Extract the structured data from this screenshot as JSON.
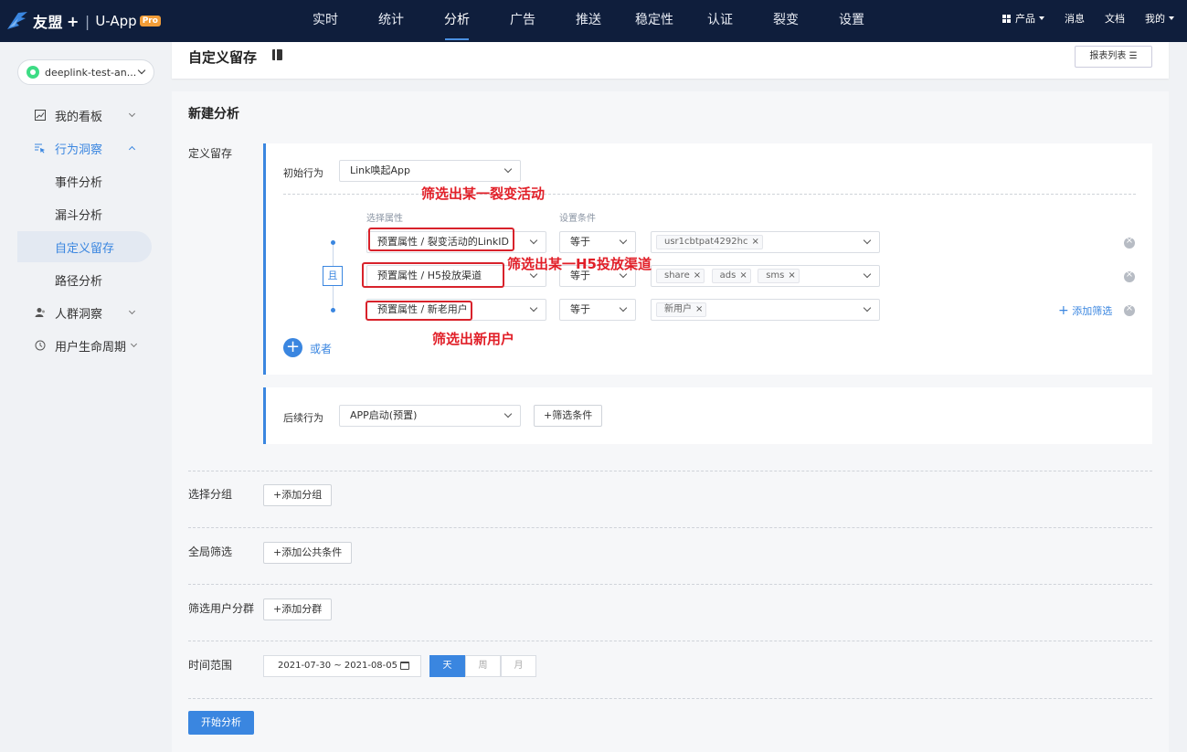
{
  "topbar": {
    "brand": "友盟",
    "brand_plus": "+",
    "separator": "|",
    "product": "U-App",
    "badge": "Pro",
    "tabs": [
      "实时",
      "统计",
      "分析",
      "广告",
      "推送",
      "稳定性",
      "认证",
      "裂变",
      "设置"
    ],
    "active_tab": "分析",
    "right": {
      "products": "产品",
      "messages": "消息",
      "docs": "文档",
      "mine": "我的"
    }
  },
  "sidebar": {
    "app_name": "deeplink-test-an...",
    "items": [
      {
        "label": "我的看板",
        "icon": "chart-icon",
        "expanded": false
      },
      {
        "label": "行为洞察",
        "icon": "cursor-list-icon",
        "expanded": true
      },
      {
        "label": "事件分析"
      },
      {
        "label": "漏斗分析"
      },
      {
        "label": "自定义留存",
        "active": true
      },
      {
        "label": "路径分析"
      },
      {
        "label": "人群洞察",
        "icon": "user-group-icon",
        "expanded": false
      },
      {
        "label": "用户生命周期",
        "icon": "cycle-icon",
        "expanded": false
      }
    ]
  },
  "header": {
    "title": "自定义留存",
    "report_list": "报表列表"
  },
  "main": {
    "section_title": "新建分析",
    "define_label": "定义留存",
    "initial": {
      "label": "初始行为",
      "value": "Link唤起App",
      "attr_hint": "选择属性",
      "cond_hint": "设置条件",
      "and_label": "且",
      "filters": [
        {
          "attr": "预置属性 / 裂变活动的LinkID",
          "op": "等于",
          "tags": [
            "usr1cbtpat4292hc"
          ]
        },
        {
          "attr": "预置属性 / H5投放渠道",
          "op": "等于",
          "tags": [
            "share",
            "ads",
            "sms"
          ]
        },
        {
          "attr": "预置属性 / 新老用户",
          "op": "等于",
          "tags": [
            "新用户"
          ]
        }
      ],
      "add_filter": "添加筛选",
      "or_label": "或者"
    },
    "annotations": [
      "筛选出某一裂变活动",
      "筛选出某一H5投放渠道",
      "筛选出新用户"
    ],
    "followup": {
      "label": "后续行为",
      "value": "APP启动(预置)",
      "add_cond": "+筛选条件"
    },
    "group": {
      "label": "选择分组",
      "button": "+添加分组"
    },
    "global_filter": {
      "label": "全局筛选",
      "button": "+添加公共条件"
    },
    "segment": {
      "label": "筛选用户分群",
      "button": "+添加分群"
    },
    "time": {
      "label": "时间范围",
      "start": "2021-07-30",
      "tilde": "~",
      "end": "2021-08-05",
      "granularity": [
        "天",
        "周",
        "月"
      ],
      "selected": "天"
    },
    "start_button": "开始分析"
  },
  "colors": {
    "nav_bg": "#0f1e3c",
    "accent": "#3a86e0",
    "annotation_red": "#e11f28"
  }
}
